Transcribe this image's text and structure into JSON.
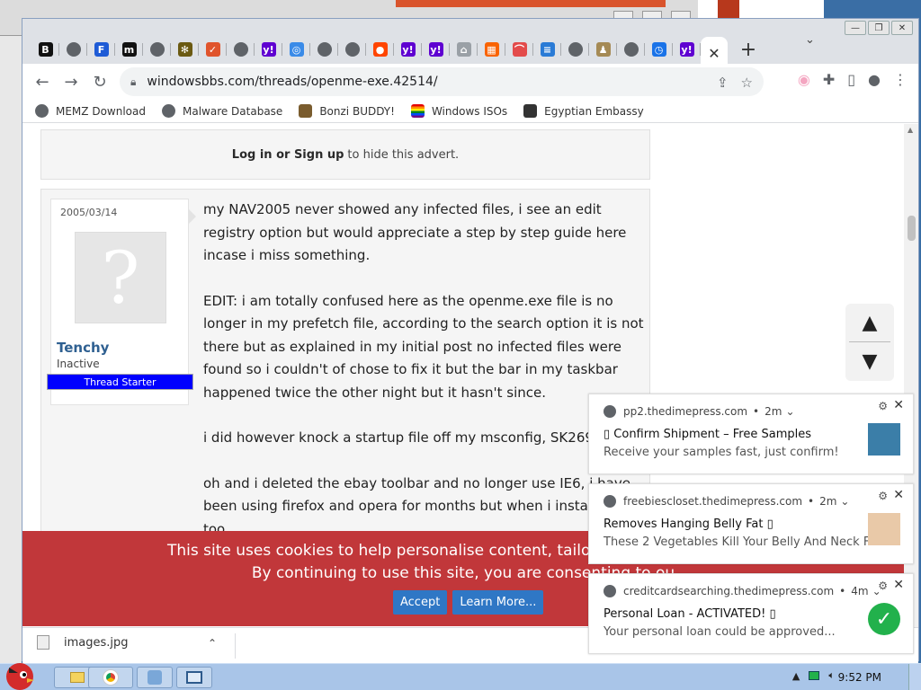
{
  "browser": {
    "tabs": [
      {
        "icon": "b-icon",
        "glyph": "B",
        "color": "#111111"
      },
      {
        "icon": "globe-icon",
        "glyph": "",
        "color": "#5f6368"
      },
      {
        "icon": "f-icon",
        "glyph": "F",
        "color": "#1e5bd6"
      },
      {
        "icon": "m-icon",
        "glyph": "m",
        "color": "#111111"
      },
      {
        "icon": "globe-icon",
        "glyph": "",
        "color": "#5f6368"
      },
      {
        "icon": "leaf-icon",
        "glyph": "✻",
        "color": "#6b5a12"
      },
      {
        "icon": "check-icon",
        "glyph": "✓",
        "color": "#e0542c"
      },
      {
        "icon": "globe-icon",
        "glyph": "",
        "color": "#5f6368"
      },
      {
        "icon": "yahoo-icon",
        "glyph": "y!",
        "color": "#5f01d1"
      },
      {
        "icon": "map-icon",
        "glyph": "◎",
        "color": "#3a8be8"
      },
      {
        "icon": "globe-icon",
        "glyph": "",
        "color": "#5f6368"
      },
      {
        "icon": "globe-icon",
        "glyph": "",
        "color": "#5f6368"
      },
      {
        "icon": "reddit-icon",
        "glyph": "●",
        "color": "#ff4500"
      },
      {
        "icon": "yahoo-icon",
        "glyph": "y!",
        "color": "#5f01d1"
      },
      {
        "icon": "yahoo-icon",
        "glyph": "y!",
        "color": "#5f01d1"
      },
      {
        "icon": "home-icon",
        "glyph": "⌂",
        "color": "#9aa0a6"
      },
      {
        "icon": "home-depot-icon",
        "glyph": "▦",
        "color": "#f96302"
      },
      {
        "icon": "rainbow-icon",
        "glyph": "⌒",
        "color": "#e34b4b"
      },
      {
        "icon": "chart-icon",
        "glyph": "≡",
        "color": "#2a7bd6"
      },
      {
        "icon": "globe-icon",
        "glyph": "",
        "color": "#5f6368"
      },
      {
        "icon": "person-icon",
        "glyph": "♟",
        "color": "#a58a55"
      },
      {
        "icon": "globe-icon",
        "glyph": "",
        "color": "#5f6368"
      },
      {
        "icon": "history-icon",
        "glyph": "◷",
        "color": "#1a73e8"
      },
      {
        "icon": "yahoo-icon",
        "glyph": "y!",
        "color": "#5f01d1"
      }
    ],
    "active_tab_close": "✕",
    "new_tab": "+",
    "url": "windowsbbs.com/threads/openme-exe.42514/",
    "bookmarks": [
      {
        "label": "MEMZ Download",
        "icon": "globe-icon"
      },
      {
        "label": "Malware Database",
        "icon": "globe-icon"
      },
      {
        "label": "Bonzi BUDDY!",
        "icon": "bonzi-icon"
      },
      {
        "label": "Windows ISOs",
        "icon": "rainbow-flag-icon"
      },
      {
        "label": "Egyptian Embassy",
        "icon": "wix-icon"
      }
    ]
  },
  "advert": {
    "link": "Log in or Sign up",
    "text": "to hide this advert."
  },
  "post": {
    "date": "2005/03/14",
    "username": "Tenchy",
    "status": "Inactive",
    "badge": "Thread Starter",
    "paragraphs": [
      "my NAV2005 never showed any infected files, i see an edit registry option but would appreciate a step by step guide here incase i miss something.",
      "EDIT: i am totally confused here as the openme.exe file is no longer in my prefetch file, according to the search option it is not there but as explained in my initial post no infected files were found so i couldn't of chose to fix it but the bar in my taskbar happened twice the other night but it hasn't since.",
      "i did however knock a startup file off my msconfig, SK2690DM",
      "oh and i deleted the ebay toolbar and no longer use IE6, i have been using firefox and opera for months but when i installed the too"
    ]
  },
  "cookie": {
    "line1": "This site uses cookies to help personalise content, tailor your experience and",
    "line2": "By continuing to use this site, you are consenting to ou",
    "accept": "Accept",
    "learn_more": "Learn More..."
  },
  "downloads": {
    "file": "images.jpg"
  },
  "notifications": [
    {
      "source": "pp2.thedimepress.com",
      "age": "2m",
      "title": "▯ Confirm Shipment – Free Samples",
      "body": "Receive your samples fast, just confirm!"
    },
    {
      "source": "freebiescloset.thedimepress.com",
      "age": "2m",
      "title": "Removes Hanging Belly Fat ▯",
      "body": "These 2 Vegetables Kill Your Belly And Neck Fat ..."
    },
    {
      "source": "creditcardsearching.thedimepress.com",
      "age": "4m",
      "title": "Personal Loan - ACTIVATED! ▯",
      "body": "Your personal loan could be approved..."
    }
  ],
  "taskbar": {
    "clock": "9:52 PM"
  },
  "colors": {
    "cookie_bg": "#c1373a",
    "accent_button": "#2f77c5",
    "username": "#2f6091",
    "badge": "#0000ff"
  }
}
